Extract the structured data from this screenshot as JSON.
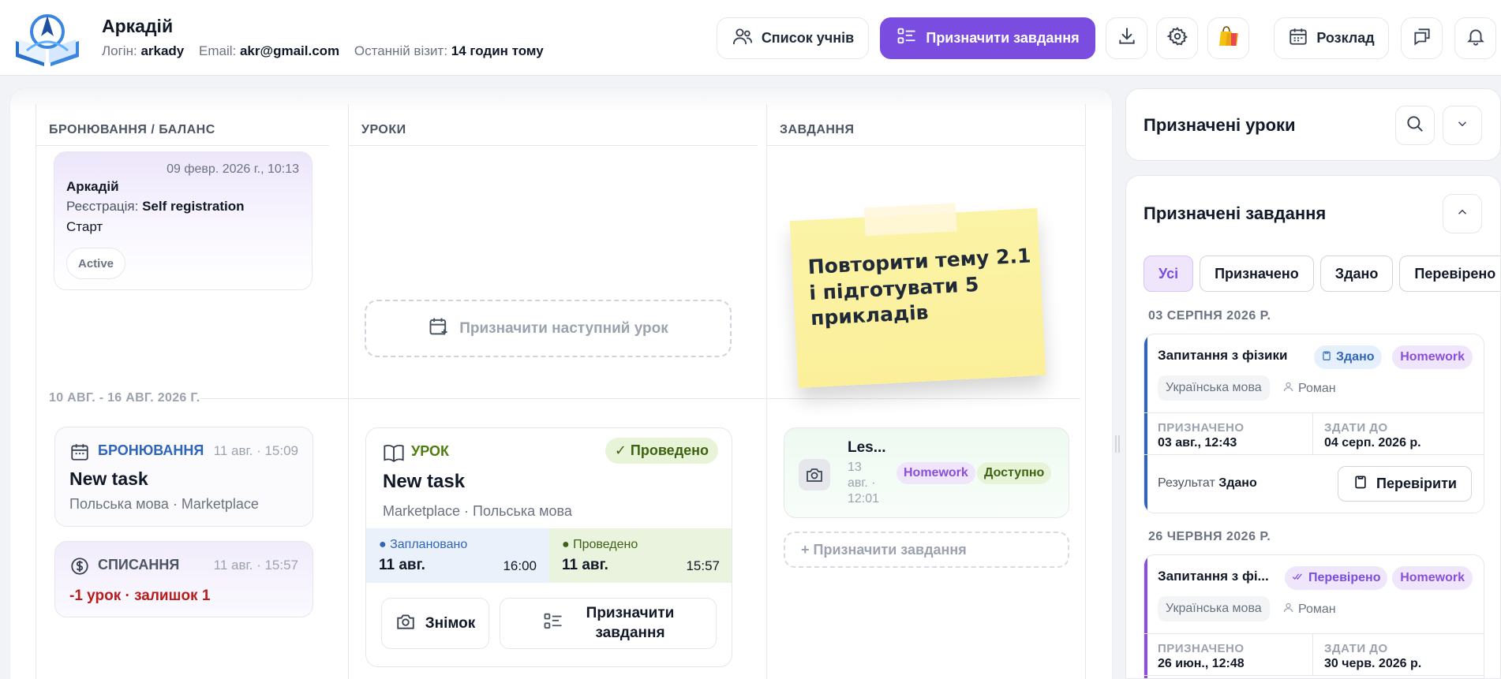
{
  "header": {
    "user_name": "Аркадій",
    "login_label": "Логін:",
    "login_value": "arkady",
    "email_label": "Email:",
    "email_value": "akr@gmail.com",
    "last_visit_label": "Останній візит:",
    "last_visit_value": "14 годин тому",
    "students_button": "Список учнів",
    "assign_tasks_button": "Призначити завдання",
    "schedule_button": "Розклад",
    "accent_color": "#7a4de0"
  },
  "columns": {
    "booking": "БРОНЮВАННЯ / БАЛАНС",
    "lessons": "УРОКИ",
    "tasks": "ЗАВДАННЯ"
  },
  "registration_card": {
    "date": "09 февр. 2026 г., 10:13",
    "name": "Аркадій",
    "reg_label": "Реєстрація:",
    "reg_value": "Self registration",
    "start": "Старт",
    "badge": "Active"
  },
  "assign_next_lesson": "Призначити наступний урок",
  "sticky_note": {
    "line1": "Повторити тему 2.1",
    "line2": "і підготувати 5",
    "line3": "прикладів"
  },
  "week_label": "10 АВГ. - 16 АВГ. 2026 Г.",
  "booking_card": {
    "type": "БРОНЮВАННЯ",
    "time": "11 авг. · 15:09",
    "title": "New task",
    "subtitle": "Польська мова · Marketplace"
  },
  "debit_card": {
    "type": "СПИСАННЯ",
    "time": "11 авг. · 15:57",
    "amount": "-1 урок · залишок 1"
  },
  "lesson_card": {
    "type": "УРОК",
    "status": "✓ Проведено",
    "title": "New task",
    "subtitle": "Marketplace · Польська мова",
    "planned_label": "● Заплановано",
    "planned_day": "11 авг.",
    "planned_time": "16:00",
    "done_label": "● Проведено",
    "done_day": "11 авг.",
    "done_time": "15:57",
    "snapshot_button": "Знімок",
    "assign_button_line1": "Призначити",
    "assign_button_line2": "завдання"
  },
  "task_card": {
    "name": "Les...",
    "meta_line1": "13",
    "meta_line2": "авг. ·",
    "meta_line3": "12:01",
    "tag_homework": "Homework",
    "tag_available": "Доступно"
  },
  "assign_task_link": "+   Призначити завдання",
  "right_panel": {
    "assigned_lessons_title": "Призначені уроки",
    "assigned_tasks_title": "Призначені завдання",
    "filters": [
      "Усі",
      "Призначено",
      "Здано",
      "Перевірено"
    ],
    "groups": [
      {
        "date": "03 СЕРПНЯ 2026 Р.",
        "task": {
          "title": "Запитання з фізики",
          "status": "Здано",
          "tag": "Homework",
          "subject": "Українська мова",
          "teacher": "Роман",
          "assigned_label": "ПРИЗНАЧЕНО",
          "assigned_value": "03 авг., 12:43",
          "due_label": "ЗДАТИ ДО",
          "due_value": "04 серп. 2026 р.",
          "result_label": "Результат",
          "result_value": "Здано",
          "check_button": "Перевірити"
        }
      },
      {
        "date": "26 ЧЕРВНЯ 2026 Р.",
        "task": {
          "title": "Запитання з фі...",
          "status": "Перевірено",
          "tag": "Homework",
          "subject": "Українська мова",
          "teacher": "Роман",
          "assigned_label": "ПРИЗНАЧЕНО",
          "assigned_value": "26 июн., 12:48",
          "due_label": "ЗДАТИ ДО",
          "due_value": "30 черв. 2026 р."
        }
      }
    ]
  }
}
